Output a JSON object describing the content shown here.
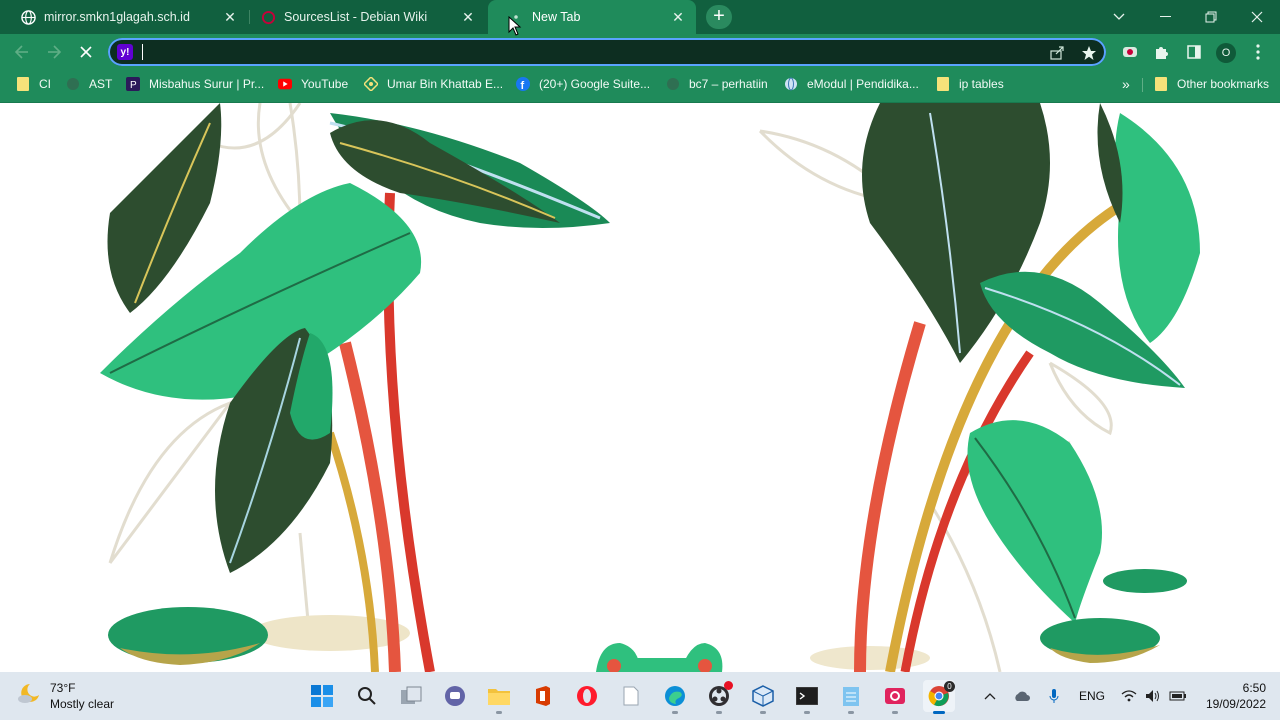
{
  "browser": {
    "tabs": [
      {
        "title": "mirror.smkn1glagah.sch.id",
        "favicon": "globe-icon",
        "active": false
      },
      {
        "title": "SourcesList - Debian Wiki",
        "favicon": "debian-icon",
        "active": false
      },
      {
        "title": "New Tab",
        "favicon": "loading-icon",
        "active": true
      }
    ],
    "address_bar": {
      "value": "",
      "placeholder": ""
    },
    "profile_initial": "O",
    "bookmarks": [
      {
        "label": "CI",
        "icon": "folder-icon"
      },
      {
        "label": "AST",
        "icon": "page-icon"
      },
      {
        "label": "Misbahus Surur | Pr...",
        "icon": "blog-icon"
      },
      {
        "label": "YouTube",
        "icon": "youtube-icon"
      },
      {
        "label": "Umar Bin Khattab E...",
        "icon": "diamond-icon"
      },
      {
        "label": "(20+) Google Suite...",
        "icon": "facebook-icon"
      },
      {
        "label": "bc7 – perhatiin",
        "icon": "page-icon"
      },
      {
        "label": "eModul | Pendidika...",
        "icon": "globe-icon"
      },
      {
        "label": "ip tables",
        "icon": "folder-icon"
      }
    ],
    "overflow_label": "»",
    "other_bookmarks": "Other bookmarks"
  },
  "taskbar": {
    "weather": {
      "temp": "73°F",
      "condition": "Mostly clear",
      "icon": "moon-cloud-icon"
    },
    "apps": [
      "windows-start-icon",
      "search-icon",
      "task-view-icon",
      "teams-chat-icon",
      "file-explorer-icon",
      "office-icon",
      "opera-icon",
      "notepad-file-icon",
      "edge-icon",
      "obs-icon",
      "virtualbox-icon",
      "terminal-icon",
      "notepad-icon",
      "video-recorder-icon",
      "chrome-icon"
    ],
    "language": "ENG",
    "time": "6:50",
    "date": "19/09/2022",
    "chrome_badge": "0"
  },
  "colors": {
    "tabstrip": "#11603f",
    "toolbar": "#1f8b5b",
    "omnibox": "#0d2e21",
    "focus_ring": "#5aa3ff",
    "taskbar": "#dfe7ef"
  }
}
